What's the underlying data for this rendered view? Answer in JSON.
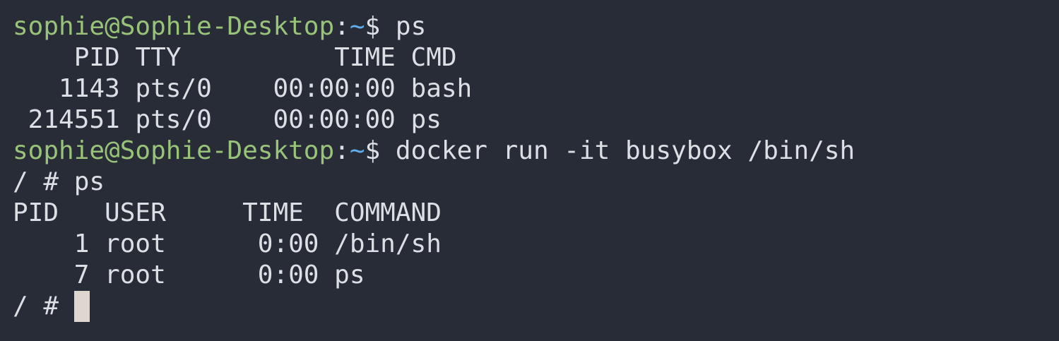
{
  "terminal": {
    "prompt": {
      "user_host": "sophie@Sophie-Desktop",
      "separator": ":",
      "path": "~",
      "symbol": "$ "
    },
    "colors": {
      "background": "#282c36",
      "foreground": "#dcdfe4",
      "prompt_user_host": "#98c379",
      "prompt_path": "#61afef",
      "cursor": "#ddd7cf"
    },
    "lines": [
      {
        "type": "prompt",
        "command": "ps"
      },
      {
        "type": "output",
        "text": "    PID TTY          TIME CMD"
      },
      {
        "type": "output",
        "text": "   1143 pts/0    00:00:00 bash"
      },
      {
        "type": "output",
        "text": " 214551 pts/0    00:00:00 ps"
      },
      {
        "type": "prompt",
        "command": "docker run -it busybox /bin/sh"
      },
      {
        "type": "output",
        "text": "/ # ps"
      },
      {
        "type": "output",
        "text": "PID   USER     TIME  COMMAND"
      },
      {
        "type": "output",
        "text": "    1 root      0:00 /bin/sh"
      },
      {
        "type": "output",
        "text": "    7 root      0:00 ps"
      }
    ],
    "current_prompt": "/ # "
  }
}
